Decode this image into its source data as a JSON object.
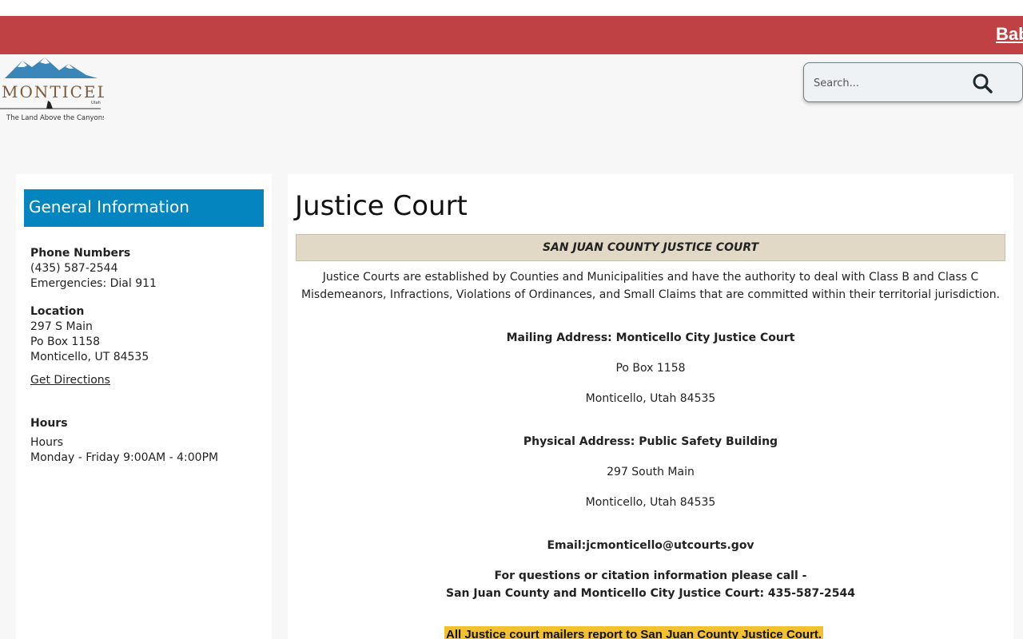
{
  "alert_bar": {
    "link_text": "Bab"
  },
  "logo": {
    "name": "MONTICELLO",
    "state": "Utah",
    "tagline": "The Land Above the Canyons"
  },
  "search": {
    "placeholder": "Search..."
  },
  "sidebar": {
    "title": "General Information",
    "phone": {
      "heading": "Phone Numbers",
      "main": "(435) 587-2544",
      "emergency": "Emergencies: Dial 911"
    },
    "location": {
      "heading": "Location",
      "line1": "297 S Main",
      "line2": "Po Box 1158",
      "line3": "Monticello, UT 84535",
      "directions_link": "Get Directions"
    },
    "hours": {
      "heading": "Hours",
      "label": "Hours",
      "schedule": "Monday - Friday 9:00AM - 4:00PM"
    }
  },
  "main": {
    "title": "Justice Court",
    "banner": "SAN JUAN COUNTY JUSTICE COURT",
    "intro_line1": "Justice Courts are established by Counties and Municipalities and have the authority to deal with Class B and Class C",
    "intro_line2": "Misdemeanors, Infractions, Violations of Ordinances, and Small Claims that are committed within their territorial jurisdiction.",
    "mailing_heading": "Mailing Address: Monticello City Justice Court",
    "mailing_line1": "Po Box 1158",
    "mailing_line2": "Monticello, Utah 84535",
    "physical_heading": "Physical Address: Public Safety Building",
    "physical_line1": "297 South Main",
    "physical_line2": "Monticello, Utah 84535",
    "email": "Email:jcmonticello@utcourts.gov",
    "questions_line1": "For questions or citation information please call -",
    "questions_line2": "San Juan County and Monticello City Justice Court: 435-587-2544",
    "highlight_notice": "All Justice court mailers report to San Juan County Justice Court."
  },
  "colors": {
    "alert_bar": "#bf4143",
    "sidebar_header": "#0585bf",
    "banner": "#e2d8c6",
    "highlight": "#f2c12e"
  }
}
